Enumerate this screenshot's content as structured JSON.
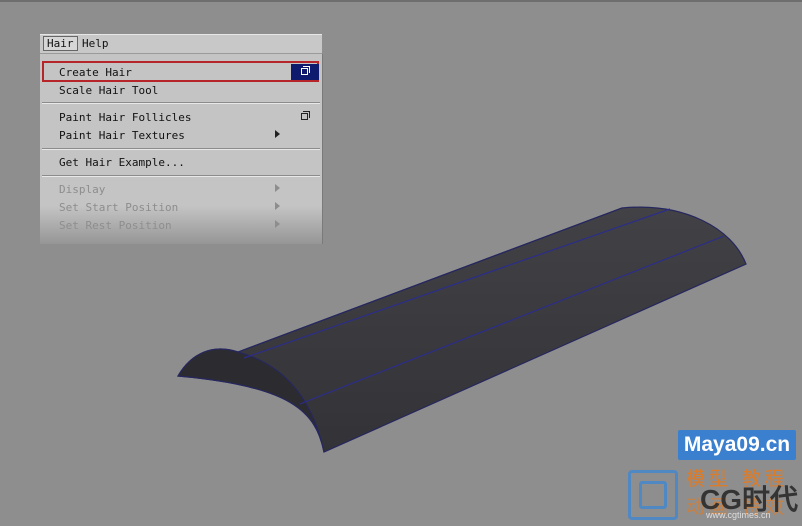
{
  "menubar": {
    "hair": "Hair",
    "help": "Help"
  },
  "menu": {
    "create_hair": "Create Hair",
    "scale_hair_tool": "Scale Hair Tool",
    "paint_hair_follicles": "Paint Hair Follicles",
    "paint_hair_textures": "Paint Hair Textures",
    "get_hair_example": "Get Hair Example...",
    "display": "Display",
    "set_start_position": "Set Start Position",
    "set_rest_position": "Set Rest Position"
  },
  "watermark": {
    "site": "Maya09.cn",
    "zh_line1": "模型 教程",
    "cg": "CG时代",
    "zh_line2": "动画 特效",
    "url": "www.cgtimes.cn"
  },
  "colors": {
    "viewport_bg": "#8e8e8e",
    "surface": "#3a3a3e",
    "isoparm": "#2b2d8a",
    "highlight": "#b5252a",
    "option_box": "#0d1a6e"
  }
}
